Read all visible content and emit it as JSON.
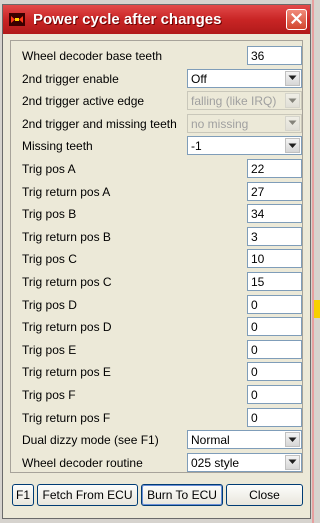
{
  "window": {
    "title": "Power cycle after changes"
  },
  "fields": [
    {
      "label": "Wheel decoder base teeth",
      "type": "text",
      "value": "36"
    },
    {
      "label": "2nd trigger enable",
      "type": "select",
      "value": "Off",
      "enabled": true
    },
    {
      "label": "2nd trigger active edge",
      "type": "select",
      "value": "falling (like IRQ)",
      "enabled": false
    },
    {
      "label": "2nd trigger and missing teeth",
      "type": "select",
      "value": "no missing",
      "enabled": false
    },
    {
      "label": "Missing teeth",
      "type": "select",
      "value": "-1",
      "enabled": true
    },
    {
      "label": "Trig pos A",
      "type": "text",
      "value": "22"
    },
    {
      "label": "Trig return pos A",
      "type": "text",
      "value": "27"
    },
    {
      "label": "Trig pos B",
      "type": "text",
      "value": "34"
    },
    {
      "label": "Trig return pos B",
      "type": "text",
      "value": "3"
    },
    {
      "label": "Trig pos C",
      "type": "text",
      "value": "10"
    },
    {
      "label": "Trig return pos C",
      "type": "text",
      "value": "15"
    },
    {
      "label": "Trig pos D",
      "type": "text",
      "value": "0"
    },
    {
      "label": "Trig return pos D",
      "type": "text",
      "value": "0"
    },
    {
      "label": "Trig pos E",
      "type": "text",
      "value": "0"
    },
    {
      "label": "Trig return pos E",
      "type": "text",
      "value": "0"
    },
    {
      "label": "Trig pos F",
      "type": "text",
      "value": "0"
    },
    {
      "label": "Trig return pos F",
      "type": "text",
      "value": "0"
    },
    {
      "label": "Dual dizzy mode (see F1)",
      "type": "select",
      "value": "Normal",
      "enabled": true
    },
    {
      "label": "Wheel decoder routine",
      "type": "select",
      "value": "025 style",
      "enabled": true
    }
  ],
  "buttons": {
    "f1": "F1",
    "fetch": "Fetch From ECU",
    "burn": "Burn To ECU",
    "close": "Close"
  },
  "icons": {
    "app": "app-logo-icon",
    "close": "close-icon",
    "dropdown": "chevron-down-icon"
  },
  "colors": {
    "titlebar": "#c92525",
    "dialog_bg": "#ece9d8",
    "field_border": "#7f9db9"
  }
}
